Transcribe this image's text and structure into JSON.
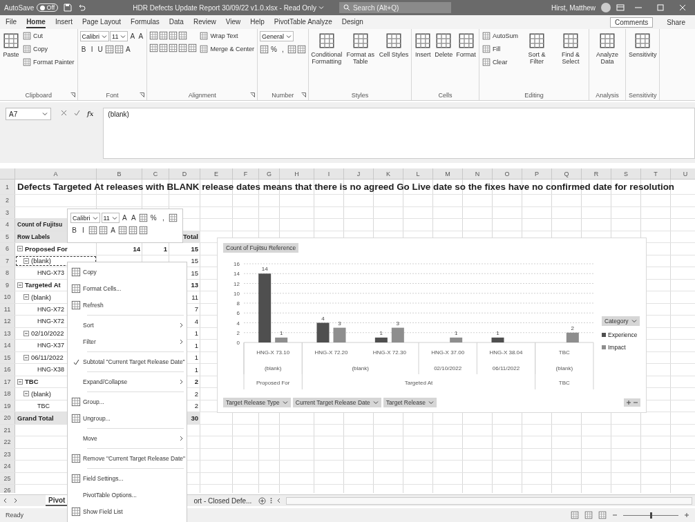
{
  "title_bar": {
    "autosave": {
      "label": "AutoSave",
      "state": "Off",
      "on": false
    },
    "title": "HDR Defects Update Report 30/09/22 v1.0.xlsx - Read Only",
    "search": {
      "placeholder": "Search (Alt+Q)"
    },
    "user": "Hirst, Matthew"
  },
  "ribbon": {
    "tabs": [
      {
        "label": "File",
        "selected": false
      },
      {
        "label": "Home",
        "selected": true
      },
      {
        "label": "Insert",
        "selected": false
      },
      {
        "label": "Page Layout",
        "selected": false
      },
      {
        "label": "Formulas",
        "selected": false
      },
      {
        "label": "Data",
        "selected": false
      },
      {
        "label": "Review",
        "selected": false
      },
      {
        "label": "View",
        "selected": false
      },
      {
        "label": "Help",
        "selected": false
      },
      {
        "label": "PivotTable Analyze",
        "selected": false
      },
      {
        "label": "Design",
        "selected": false
      }
    ],
    "actions": [
      "Comments",
      "Share"
    ],
    "groups": [
      {
        "label": "Clipboard",
        "launcher": true,
        "columns": [
          [
            [
              {
                "kind": "large",
                "label": "Paste"
              }
            ]
          ],
          [
            [
              {
                "kind": "small",
                "label": "Cut"
              }
            ],
            [
              {
                "kind": "small",
                "label": "Copy"
              }
            ],
            [
              {
                "kind": "small",
                "label": "Format Painter"
              }
            ]
          ]
        ]
      },
      {
        "label": "Font",
        "launcher": true,
        "columns": [
          [
            [
              {
                "kind": "field",
                "label": "Calibri"
              },
              {
                "kind": "field",
                "label": "11"
              },
              {
                "kind": "glyph",
                "label": "A"
              },
              {
                "kind": "glyph",
                "label": "A"
              }
            ],
            [
              {
                "kind": "glyph",
                "label": "B"
              },
              {
                "kind": "glyph",
                "label": "I"
              },
              {
                "kind": "glyph",
                "label": "U"
              },
              {
                "kind": "icon"
              },
              {
                "kind": "icon"
              },
              {
                "kind": "glyph",
                "label": "A"
              }
            ]
          ]
        ]
      },
      {
        "label": "Alignment",
        "launcher": true,
        "columns": [
          [
            [
              {
                "kind": "icon"
              },
              {
                "kind": "icon"
              },
              {
                "kind": "icon"
              },
              {
                "kind": "icon"
              }
            ],
            [
              {
                "kind": "icon"
              },
              {
                "kind": "icon"
              },
              {
                "kind": "icon"
              },
              {
                "kind": "icon"
              },
              {
                "kind": "icon"
              }
            ]
          ],
          [
            [
              {
                "kind": "small",
                "label": "Wrap Text"
              }
            ],
            [
              {
                "kind": "small",
                "label": "Merge & Center"
              }
            ]
          ]
        ]
      },
      {
        "label": "Number",
        "launcher": true,
        "columns": [
          [
            [
              {
                "kind": "field",
                "label": "General"
              }
            ],
            [
              {
                "kind": "icon"
              },
              {
                "kind": "glyph",
                "label": "%"
              },
              {
                "kind": "glyph",
                "label": ","
              },
              {
                "kind": "icon"
              },
              {
                "kind": "icon"
              }
            ]
          ]
        ]
      },
      {
        "label": "Styles",
        "launcher": false,
        "columns": [
          [
            [
              {
                "kind": "large",
                "label": "Conditional Formatting"
              }
            ]
          ],
          [
            [
              {
                "kind": "large",
                "label": "Format as Table"
              }
            ]
          ],
          [
            [
              {
                "kind": "large",
                "label": "Cell Styles"
              }
            ]
          ]
        ]
      },
      {
        "label": "Cells",
        "launcher": false,
        "columns": [
          [
            [
              {
                "kind": "large",
                "label": "Insert"
              }
            ]
          ],
          [
            [
              {
                "kind": "large",
                "label": "Delete"
              }
            ]
          ],
          [
            [
              {
                "kind": "large",
                "label": "Format"
              }
            ]
          ]
        ]
      },
      {
        "label": "Editing",
        "launcher": false,
        "columns": [
          [
            [
              {
                "kind": "small",
                "label": "AutoSum"
              }
            ],
            [
              {
                "kind": "small",
                "label": "Fill"
              }
            ],
            [
              {
                "kind": "small",
                "label": "Clear"
              }
            ]
          ],
          [
            [
              {
                "kind": "large",
                "label": "Sort & Filter"
              }
            ]
          ],
          [
            [
              {
                "kind": "large",
                "label": "Find & Select"
              }
            ]
          ]
        ]
      },
      {
        "label": "Analysis",
        "launcher": false,
        "columns": [
          [
            [
              {
                "kind": "large",
                "label": "Analyze Data"
              }
            ]
          ]
        ]
      },
      {
        "label": "Sensitivity",
        "launcher": false,
        "columns": [
          [
            [
              {
                "kind": "large",
                "label": "Sensitivity"
              }
            ]
          ]
        ]
      }
    ]
  },
  "formula_bar": {
    "name_box": "A7",
    "function_label": "fx",
    "formula": "(blank)"
  },
  "sheet": {
    "columns": [
      "A",
      "B",
      "C",
      "D",
      "E",
      "F",
      "G",
      "H",
      "I",
      "J",
      "K",
      "L",
      "M",
      "N",
      "O",
      "P",
      "Q",
      "R",
      "S",
      "T",
      "U"
    ],
    "rows_top": [
      {
        "number": "1",
        "kind": "title",
        "cells": {
          "A": "Defects Targeted At releases with BLANK release dates means that there is no agreed Go Live date so the fixes have no confirmed date for resolution"
        }
      },
      {
        "number": "2",
        "kind": "plain"
      },
      {
        "number": "3",
        "kind": "plain"
      },
      {
        "number": "4",
        "kind": "pivot_header",
        "cells": {
          "A": "Count of Fujitsu"
        }
      },
      {
        "number": "5",
        "kind": "pivot_header",
        "cells": {
          "A": "Row Labels",
          "D": "Total"
        }
      }
    ],
    "pivot": [
      {
        "number": "6",
        "label": "Proposed For",
        "values": {
          "B": "14",
          "C": "1",
          "D": "15"
        },
        "expanded": true,
        "selected": false,
        "children": [
          {
            "number": "7",
            "label": "(blank)",
            "values": {
              "D": "15"
            },
            "expanded": true,
            "selected": true,
            "children": [
              {
                "number": "8",
                "label": "HNG-X73",
                "values": {
                  "D": "15"
                },
                "selected": false
              }
            ]
          }
        ]
      },
      {
        "number": "9",
        "label": "Targeted At",
        "values": {
          "D": "13"
        },
        "expanded": true,
        "selected": false,
        "children": [
          {
            "number": "10",
            "label": "(blank)",
            "values": {
              "D": "11"
            },
            "expanded": true,
            "selected": false,
            "children": [
              {
                "number": "11",
                "label": "HNG-X72",
                "values": {
                  "D": "7"
                },
                "selected": false
              },
              {
                "number": "12",
                "label": "HNG-X72",
                "values": {
                  "D": "4"
                },
                "selected": false
              }
            ]
          },
          {
            "number": "13",
            "label": "02/10/2022",
            "values": {
              "D": "1"
            },
            "expanded": true,
            "selected": false,
            "children": [
              {
                "number": "14",
                "label": "HNG-X37",
                "values": {
                  "D": "1"
                },
                "selected": false
              }
            ]
          },
          {
            "number": "15",
            "label": "06/11/2022",
            "values": {
              "D": "1"
            },
            "expanded": true,
            "selected": false,
            "children": [
              {
                "number": "16",
                "label": "HNG-X38",
                "values": {
                  "D": "1"
                },
                "selected": false
              }
            ]
          }
        ]
      },
      {
        "number": "17",
        "label": "TBC",
        "values": {
          "D": "2"
        },
        "expanded": true,
        "selected": false,
        "children": [
          {
            "number": "18",
            "label": "(blank)",
            "values": {
              "D": "2"
            },
            "expanded": true,
            "selected": false,
            "children": [
              {
                "number": "19",
                "label": "TBC",
                "values": {
                  "D": "2"
                },
                "selected": false
              }
            ]
          }
        ]
      }
    ],
    "rows_bottom": [
      {
        "number": "20",
        "kind": "total",
        "cells": {
          "A": "Grand Total",
          "D": "30"
        }
      },
      {
        "number": "21",
        "kind": "plain"
      },
      {
        "number": "22",
        "kind": "plain"
      },
      {
        "number": "23",
        "kind": "plain"
      },
      {
        "number": "24",
        "kind": "plain"
      },
      {
        "number": "25",
        "kind": "plain"
      },
      {
        "number": "26",
        "kind": "plain"
      }
    ]
  },
  "chart": {
    "value_button": "Count of Fujitsu Reference",
    "legend_button": "Category",
    "axis_buttons": [
      "Target Release Type",
      "Current Target Release Date",
      "Target Release"
    ],
    "axis_groups": [
      {
        "label": "Proposed For",
        "children": [
          {
            "label": "(blank)",
            "children": [
              {
                "label": "HNG-X 73.10"
              }
            ]
          }
        ]
      },
      {
        "label": "Targeted At",
        "children": [
          {
            "label": "(blank)",
            "children": [
              {
                "label": "HNG-X 72.20"
              },
              {
                "label": "HNG-X 72.30"
              }
            ]
          },
          {
            "label": "02/10/2022",
            "children": [
              {
                "label": "HNG-X 37.00"
              }
            ]
          },
          {
            "label": "06/11/2022",
            "children": [
              {
                "label": "HNG-X 38.04"
              }
            ]
          }
        ]
      },
      {
        "label": "TBC",
        "children": [
          {
            "label": "(blank)",
            "children": [
              {
                "label": "TBC"
              }
            ]
          }
        ]
      }
    ],
    "chart_data": {
      "type": "bar",
      "series": [
        {
          "name": "Experience",
          "color": "#4f4f4f",
          "values": [
            14,
            4,
            1,
            null,
            1,
            null
          ]
        },
        {
          "name": "Impact",
          "color": "#8e8e8e",
          "values": [
            1,
            3,
            3,
            1,
            null,
            2
          ]
        }
      ],
      "ylim": [
        0,
        16
      ],
      "yticks": [
        {
          "value": 0,
          "label": "0"
        },
        {
          "value": 2,
          "label": "2"
        },
        {
          "value": 4,
          "label": "4"
        },
        {
          "value": 6,
          "label": "6"
        },
        {
          "value": 8,
          "label": "8"
        },
        {
          "value": 10,
          "label": "10"
        },
        {
          "value": 12,
          "label": "12"
        },
        {
          "value": 14,
          "label": "14"
        },
        {
          "value": 16,
          "label": "16"
        }
      ],
      "grid": true,
      "value_labels": [
        [
          "14",
          "1"
        ],
        [
          "4",
          "3"
        ],
        [
          "1",
          "3"
        ],
        [
          "1"
        ],
        [
          "1"
        ],
        [
          "2"
        ]
      ]
    }
  },
  "mini_toolbar": {
    "font_row": [
      {
        "kind": "field",
        "label": "Calibri"
      },
      {
        "kind": "field",
        "label": "11"
      },
      {
        "kind": "glyph",
        "label": "A"
      },
      {
        "kind": "glyph",
        "label": "A"
      },
      {
        "kind": "icon"
      },
      {
        "kind": "glyph",
        "label": "%"
      },
      {
        "kind": "glyph",
        "label": ","
      },
      {
        "kind": "icon"
      }
    ],
    "format_row": [
      {
        "kind": "glyph",
        "label": "B"
      },
      {
        "kind": "glyph",
        "label": "I"
      },
      {
        "kind": "icon"
      },
      {
        "kind": "icon"
      },
      {
        "kind": "glyph",
        "label": "A"
      },
      {
        "kind": "icon"
      },
      {
        "kind": "icon"
      },
      {
        "kind": "icon"
      }
    ]
  },
  "context_menu": {
    "items": [
      {
        "kind": "item",
        "label": "Copy",
        "icon": true,
        "checked": false,
        "submenu": false
      },
      {
        "kind": "item",
        "label": "Format Cells...",
        "icon": true,
        "checked": false,
        "submenu": false
      },
      {
        "kind": "item",
        "label": "Refresh",
        "icon": true,
        "checked": false,
        "submenu": false
      },
      {
        "kind": "separator"
      },
      {
        "kind": "item",
        "label": "Sort",
        "icon": false,
        "checked": false,
        "submenu": true
      },
      {
        "kind": "item",
        "label": "Filter",
        "icon": false,
        "checked": false,
        "submenu": true
      },
      {
        "kind": "separator"
      },
      {
        "kind": "item",
        "label": "Subtotal \"Current Target Release Date\"",
        "icon": false,
        "checked": true,
        "submenu": false
      },
      {
        "kind": "separator"
      },
      {
        "kind": "item",
        "label": "Expand/Collapse",
        "icon": false,
        "checked": false,
        "submenu": true
      },
      {
        "kind": "separator"
      },
      {
        "kind": "item",
        "label": "Group...",
        "icon": true,
        "checked": false,
        "submenu": false
      },
      {
        "kind": "item",
        "label": "Ungroup...",
        "icon": true,
        "checked": false,
        "submenu": false
      },
      {
        "kind": "separator"
      },
      {
        "kind": "item",
        "label": "Move",
        "icon": false,
        "checked": false,
        "submenu": true
      },
      {
        "kind": "separator"
      },
      {
        "kind": "item",
        "label": "Remove \"Current Target Release Date\"",
        "icon": true,
        "checked": false,
        "submenu": false
      },
      {
        "kind": "separator"
      },
      {
        "kind": "item",
        "label": "Field Settings...",
        "icon": true,
        "checked": false,
        "submenu": false
      },
      {
        "kind": "item",
        "label": "PivotTable Options...",
        "icon": false,
        "checked": false,
        "submenu": false
      },
      {
        "kind": "item",
        "label": "Show Field List",
        "icon": true,
        "checked": false,
        "submenu": false
      }
    ]
  },
  "sheet_tabs": {
    "tabs": [
      {
        "label": "Pivot",
        "selected": true
      },
      {
        "label": "ort - Closed Defe...",
        "selected": false
      }
    ]
  },
  "status_bar": {
    "text": "Ready",
    "zoom": {
      "level": 0.5
    }
  }
}
